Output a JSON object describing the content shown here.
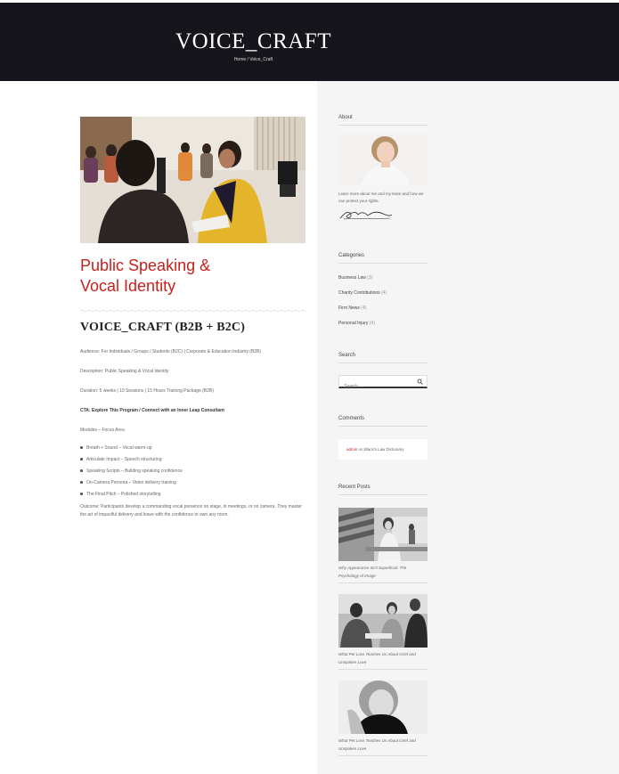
{
  "site": {
    "title": "VOICE_CRAFT",
    "breadcrumb": "Home / Voice_Craft"
  },
  "post": {
    "title_line1": "Public Speaking &",
    "title_line2": "Vocal Identity",
    "subheading": "VOICE_CRAFT (B2B + B2C)",
    "audience": "Audience: For Individuals / Groups / Students (B2C) | Corporate & Education Industry (B2B)",
    "description": "Description: Public Speaking & Vocal Identity",
    "duration": "Duration: 5 weeks | 10 Sessions | 15 Hours Training Package (B2B)",
    "cta": "CTA: Explore This Program / Connect with an Inner Leap Consultant",
    "modules_heading": "Modules – Focus Area",
    "modules": [
      "Breath + Sound – Vocal warm-up",
      "Articulate Impact – Speech structuring",
      "Speaking Scripts – Building speaking confidence",
      "On-Camera Persona – Video delivery training",
      "The Final Pitch – Polished storytelling"
    ],
    "outcome": "Outcome: Participants develop a commanding vocal presence on stage, in meetings, or on camera. They master the art of impactful delivery and leave with the confidence to own any room."
  },
  "sidebar": {
    "about": {
      "title": "About",
      "text": "Learn more about me and my team and how we can protect your rights."
    },
    "categories": {
      "title": "Categories",
      "items": [
        {
          "label": "Business Law",
          "count": "(3)"
        },
        {
          "label": "Charity Contributions",
          "count": "(4)"
        },
        {
          "label": "Firm News",
          "count": "(4)"
        },
        {
          "label": "Personal Injury",
          "count": "(4)"
        }
      ]
    },
    "search": {
      "title": "Search",
      "placeholder": "Search ..."
    },
    "comments": {
      "title": "Comments",
      "author": "admin",
      "on": "on",
      "post": "Black's Law Dictionary"
    },
    "recent": {
      "title": "Recent Posts",
      "items": [
        {
          "title": "Why Appearance Isn't Superficial: The Psychology of Image"
        },
        {
          "title": "What Pet Loss Teaches Us About Grief and Unspoken Love"
        },
        {
          "title": "What Pet Loss Teaches Us About Grief and Unspoken Love"
        }
      ]
    }
  },
  "colors": {
    "header_bg": "#16151b",
    "accent": "#c8201d",
    "sidebar_bg": "#f5f5f5"
  }
}
